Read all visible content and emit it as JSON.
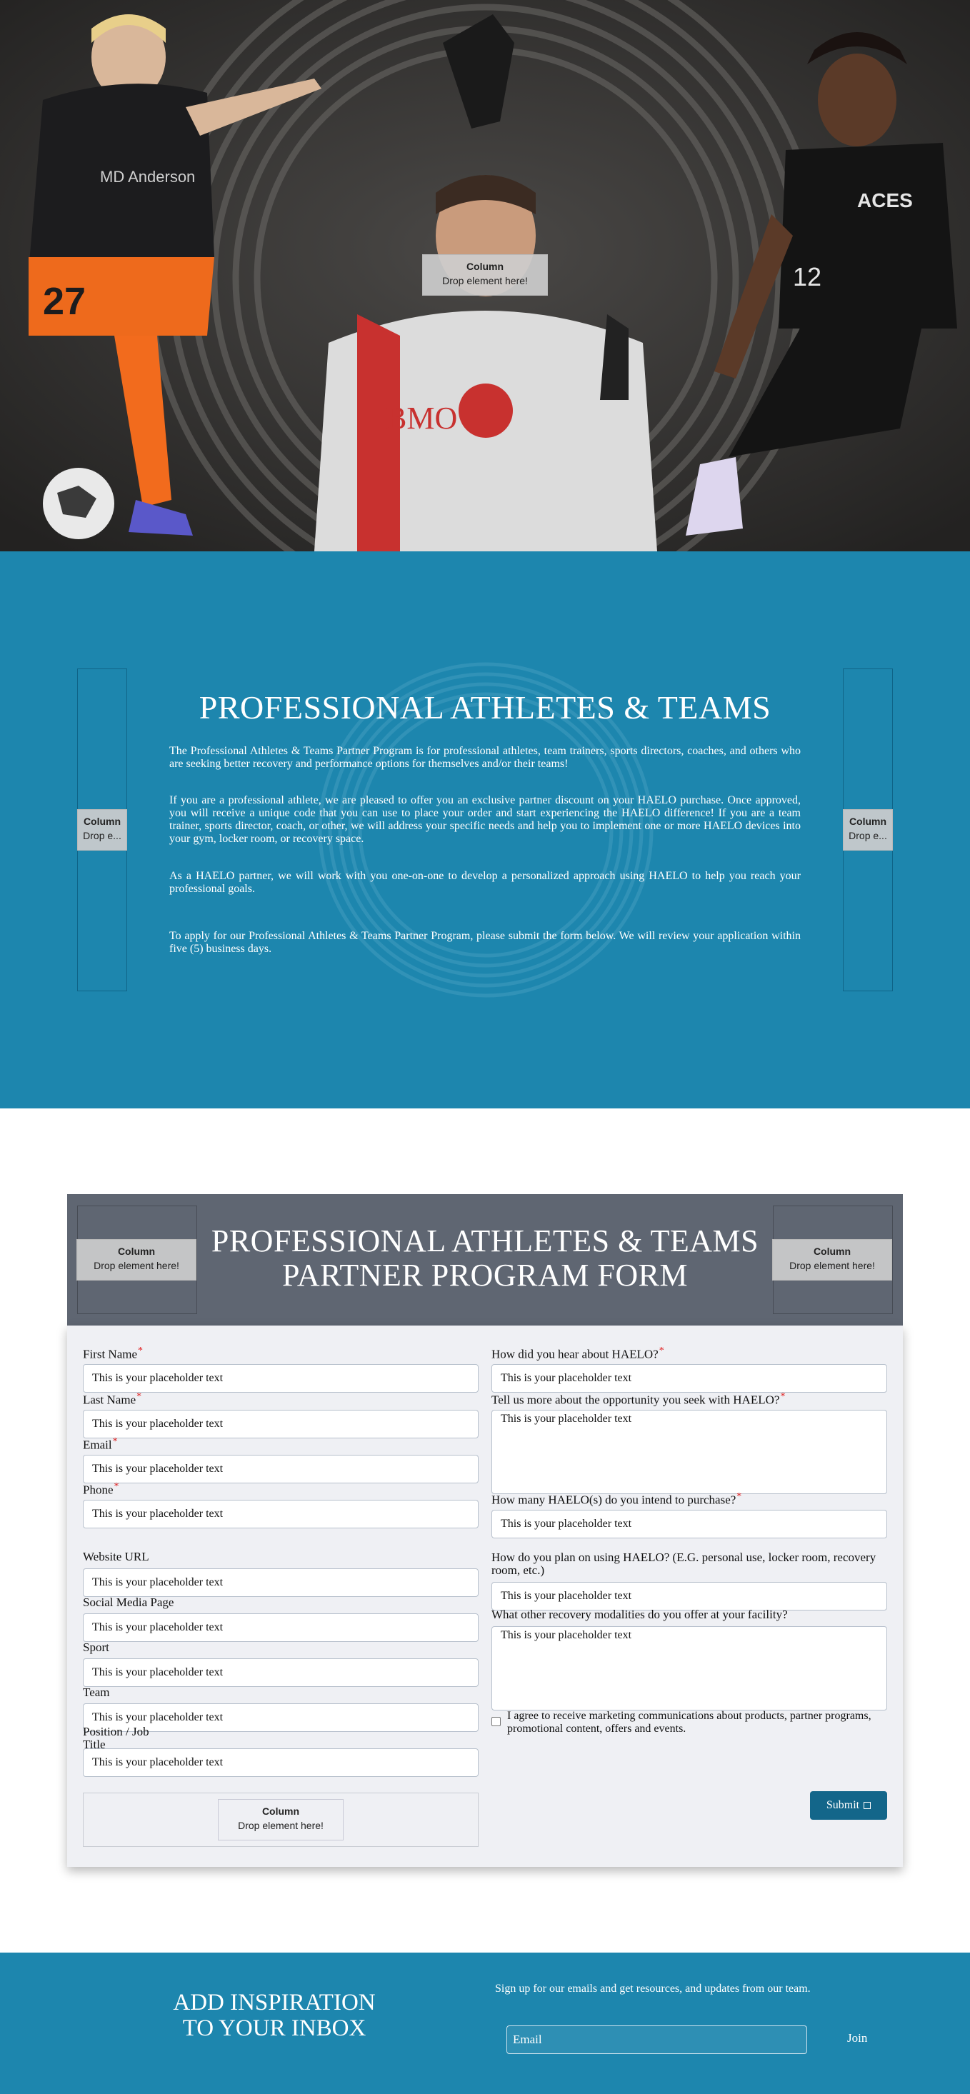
{
  "hero": {
    "column_placeholder": {
      "title": "Column",
      "text": "Drop element here!"
    }
  },
  "about": {
    "title": "PROFESSIONAL ATHLETES & TEAMS",
    "side_column_left": {
      "title": "Column",
      "text": "Drop e..."
    },
    "side_column_right": {
      "title": "Column",
      "text": "Drop e..."
    },
    "paragraphs": [
      "The Professional Athletes & Teams Partner Program is for professional athletes, team trainers, sports directors, coaches, and others who are seeking better recovery and performance options for themselves and/or their teams!",
      "If you are a professional athlete, we are pleased to offer you an exclusive partner discount on your HAELO purchase. Once approved, you will receive a unique code that you can use to place your order and start experiencing the HAELO difference! If you are a team trainer, sports director, coach, or other, we will address your specific needs and help you to implement one or more HAELO devices into your gym, locker room, or recovery space.",
      "As a HAELO partner, we will work with you one-on-one to develop a personalized approach using HAELO to help you reach your professional goals.",
      "To apply for our Professional Athletes & Teams Partner Program, please submit the form below. We will review your application within five (5) business days."
    ]
  },
  "form": {
    "heading": "PROFESSIONAL ATHLETES & TEAMS PARTNER PROGRAM FORM",
    "header_column_left": {
      "title": "Column",
      "text": "Drop element here!"
    },
    "header_column_right": {
      "title": "Column",
      "text": "Drop element here!"
    },
    "placeholder": "This is your placeholder text",
    "fields": {
      "first_name": "First Name",
      "last_name": "Last Name",
      "email": "Email",
      "phone": "Phone",
      "website": "Website URL",
      "social": "Social Media Page",
      "sport": "Sport",
      "team": "Team",
      "position": "Position / Job Title",
      "heard": "How did you hear about HAELO?",
      "opportunity": "Tell us more about the opportunity you seek with HAELO?",
      "quantity": "How many HAELO(s) do you intend to purchase?",
      "usage": "How do you plan on using HAELO? (E.G. personal use, locker room, recovery room, etc.)",
      "modalities": "What other recovery modalities do you offer at your facility?"
    },
    "required_mark": "*",
    "consent": "I agree to receive marketing communications about products, partner programs, promotional content, offers and events.",
    "bottom_column": {
      "title": "Column",
      "text": "Drop element here!"
    },
    "submit_label": "Submit"
  },
  "footer": {
    "title": "ADD INSPIRATION TO YOUR INBOX",
    "subtitle": "Sign up for our emails and get resources, and updates from our team.",
    "email_placeholder": "Email",
    "join_label": "Join"
  },
  "colors": {
    "brand_blue": "#1d86ae",
    "form_header": "#5f6672",
    "submit": "#13668a",
    "required": "#e02020"
  }
}
